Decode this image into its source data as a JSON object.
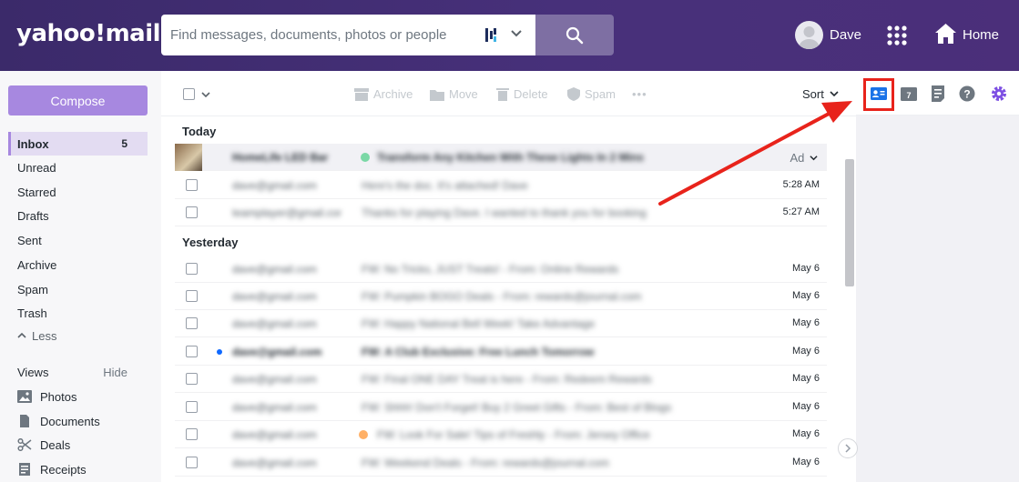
{
  "header": {
    "logo": "yahoo!mail",
    "search_placeholder": "Find messages, documents, photos or people",
    "user_name": "Dave",
    "home_label": "Home"
  },
  "sidebar": {
    "compose_label": "Compose",
    "folders": [
      {
        "label": "Inbox",
        "count": "5",
        "active": true
      },
      {
        "label": "Unread"
      },
      {
        "label": "Starred"
      },
      {
        "label": "Drafts"
      },
      {
        "label": "Sent"
      },
      {
        "label": "Archive"
      },
      {
        "label": "Spam"
      },
      {
        "label": "Trash"
      }
    ],
    "less_label": "Less",
    "views_label": "Views",
    "hide_label": "Hide",
    "views": [
      {
        "label": "Photos",
        "icon": "photo-icon"
      },
      {
        "label": "Documents",
        "icon": "document-icon"
      },
      {
        "label": "Deals",
        "icon": "scissors-icon"
      },
      {
        "label": "Receipts",
        "icon": "receipt-icon"
      }
    ]
  },
  "toolbar": {
    "archive": "Archive",
    "move": "Move",
    "delete": "Delete",
    "spam": "Spam",
    "more": "•••",
    "sort": "Sort"
  },
  "messages": {
    "today_label": "Today",
    "yesterday_label": "Yesterday",
    "ad_label": "Ad",
    "today": [
      {
        "sender": "HomeLife LED Bar",
        "subject": "Transform Any Kitchen With These Lights In 2 Mins",
        "time": "",
        "ad": true
      },
      {
        "sender": "dave@gmail.com",
        "subject": "Here's the doc. It's attached! Dave",
        "time": "5:28 AM"
      },
      {
        "sender": "teamplayer@gmail.com",
        "subject": "Thanks for playing Dave. I wanted to thank you for booking",
        "time": "5:27 AM"
      }
    ],
    "yesterday": [
      {
        "sender": "dave@gmail.com",
        "subject": "FW: No Tricks, JUST Treats! - From: Online Rewards",
        "time": "May 6"
      },
      {
        "sender": "dave@gmail.com",
        "subject": "FW: Pumpkin BOGO Deals - From: rewards@journal.com",
        "time": "May 6"
      },
      {
        "sender": "dave@gmail.com",
        "subject": "FW: Happy National Bell Week! Take Advantage",
        "time": "May 6"
      },
      {
        "sender": "dave@gmail.com",
        "subject": "FW: A Club Exclusive: Free Lunch Tomorrow",
        "time": "May 6",
        "unread": true
      },
      {
        "sender": "dave@gmail.com",
        "subject": "FW: Final ONE DAY Treat is here - From: Redeem Rewards",
        "time": "May 6"
      },
      {
        "sender": "dave@gmail.com",
        "subject": "FW: Shhh! Don't Forget! Buy 2 Greet Gifts - From: Best of Blogs",
        "time": "May 6"
      },
      {
        "sender": "dave@gmail.com",
        "subject": "FW: Look For Sale! Tips of Freshly - From: Jersey Office",
        "time": "May 6",
        "tag": true
      },
      {
        "sender": "dave@gmail.com",
        "subject": "FW: Weekend Deals - From: rewards@journal.com",
        "time": "May 6"
      }
    ]
  },
  "colors": {
    "header_bg": "#3f2d72",
    "accent": "#a788e0",
    "annotation_red": "#e8231b"
  }
}
